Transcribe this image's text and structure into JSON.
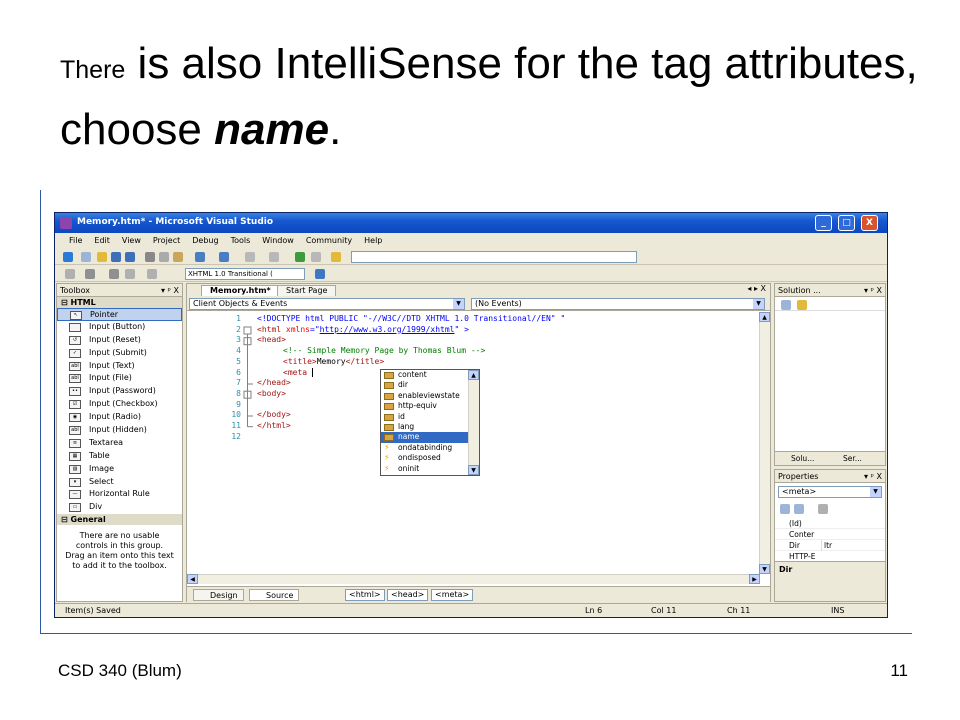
{
  "slide": {
    "title_small": "There",
    "title_main": " is also IntelliSense for the tag attributes, choose ",
    "title_emph": "name",
    "title_end": ".",
    "footer_left": "CSD 340 (Blum)",
    "footer_right": "11"
  },
  "window": {
    "title": "Memory.htm* - Microsoft Visual Studio",
    "buttons": [
      "_",
      "□",
      "X"
    ]
  },
  "menu": [
    "File",
    "Edit",
    "View",
    "Project",
    "Debug",
    "Tools",
    "Window",
    "Community",
    "Help"
  ],
  "toolbar2": {
    "doctype": "XHTML 1.0 Transitional ("
  },
  "toolbox": {
    "header": "Toolbox",
    "controls": "▾ ᵖ X",
    "html_group": "HTML",
    "items": [
      "Pointer",
      "Input (Button)",
      "Input (Reset)",
      "Input (Submit)",
      "Input (Text)",
      "Input (File)",
      "Input (Password)",
      "Input (Checkbox)",
      "Input (Radio)",
      "Input (Hidden)",
      "Textarea",
      "Table",
      "Image",
      "Select",
      "Horizontal Rule",
      "Div"
    ],
    "general_group": "General",
    "empty_message": "There are no usable controls in this group. Drag an item onto this text to add it to the toolbox."
  },
  "editor": {
    "tabs": [
      "Memory.htm*",
      "Start Page"
    ],
    "tab_controls": "◂ ▸ X",
    "objects_combo": "Client Objects & Events",
    "events_combo": "(No Events)",
    "line_numbers": [
      "1",
      "2",
      "3",
      "4",
      "5",
      "6",
      "7",
      "8",
      "9",
      "10",
      "11",
      "12"
    ],
    "lines": {
      "l1a": "<!DOCTYPE html PUBLIC ",
      "l1b": "\"-//W3C//DTD XHTML 1.0 Transitional//EN\" \"",
      "l2a": "<html ",
      "l2b": "xmlns",
      "l2c": "=\"",
      "l2d": "http://www.w3.org/1999/xhtml",
      "l2e": "\" >",
      "l3": "<head>",
      "l4": "<!-- Simple Memory Page by Thomas Blum -->",
      "l5a": "<title>",
      "l5b": "Memory",
      "l5c": "</title>",
      "l6": "<meta ",
      "l7": "</head>",
      "l8": "<body>",
      "l10": "</body>",
      "l11": "</html>"
    },
    "view_buttons": [
      "Design",
      "Source"
    ],
    "breadcrumbs": [
      "<html>",
      "<head>",
      "<meta>"
    ]
  },
  "intellisense": {
    "items": [
      "content",
      "dir",
      "enableviewstate",
      "http-equiv",
      "id",
      "lang",
      "name",
      "ondatabinding",
      "ondisposed",
      "oninit"
    ],
    "selected": "name"
  },
  "solution": {
    "header": "Solution ...",
    "controls": "▾ ᵖ X",
    "tabs": [
      "Solu...",
      "Ser..."
    ]
  },
  "properties": {
    "header": "Properties",
    "controls": "▾ ᵖ X",
    "object": "<meta>",
    "rows": [
      {
        "name": "(Id)",
        "value": ""
      },
      {
        "name": "Conter",
        "value": ""
      },
      {
        "name": "Dir",
        "value": "ltr"
      },
      {
        "name": "HTTP-E",
        "value": ""
      }
    ],
    "description": "Dir"
  },
  "status": {
    "message": "Item(s) Saved",
    "ln": "Ln 6",
    "col": "Col 11",
    "ch": "Ch 11",
    "mode": "INS"
  }
}
